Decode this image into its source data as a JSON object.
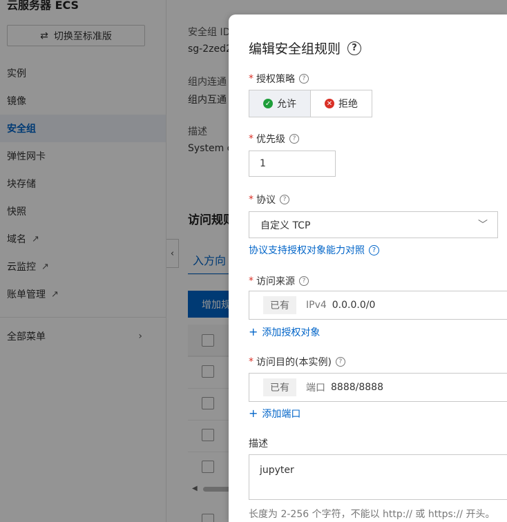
{
  "sidebar": {
    "title": "云服务器 ECS",
    "switch_button": "切换至标准版",
    "items": [
      {
        "label": "实例"
      },
      {
        "label": "镜像"
      },
      {
        "label": "安全组"
      },
      {
        "label": "弹性网卡"
      },
      {
        "label": "块存储"
      },
      {
        "label": "快照"
      },
      {
        "label": "域名"
      },
      {
        "label": "云监控"
      },
      {
        "label": "账单管理"
      }
    ],
    "all_menu": "全部菜单"
  },
  "main": {
    "sg_id_label": "安全组 ID",
    "sg_id_value": "sg-2zed2",
    "intra_label": "组内连通",
    "intra_value": "组内互通",
    "desc_label": "描述",
    "desc_value": "System c",
    "rules_title": "访问规则",
    "tab_inbound": "入方向",
    "add_rule_button": "增加规"
  },
  "drawer": {
    "title": "编辑安全组规则",
    "policy": {
      "label": "授权策略",
      "allow": "允许",
      "deny": "拒绝",
      "selected": "允许"
    },
    "priority": {
      "label": "优先级",
      "value": "1"
    },
    "protocol": {
      "label": "协议",
      "value": "自定义 TCP",
      "link": "协议支持授权对象能力对照"
    },
    "source": {
      "label": "访问来源",
      "tag": "已有",
      "key": "IPv4",
      "value": "0.0.0.0/0",
      "add_link": "添加授权对象"
    },
    "destination": {
      "label": "访问目的(本实例)",
      "tag": "已有",
      "key": "端口",
      "value": "8888/8888",
      "add_link": "添加端口"
    },
    "description": {
      "label": "描述",
      "value": "jupyter",
      "hint": "长度为 2-256 个字符，不能以 http:// 或 https:// 开头。"
    }
  },
  "colors": {
    "accent": "#0064c8",
    "required": "#d93026",
    "allow_green": "#1e9e3a",
    "overlay": "rgba(0,0,0,0.42)"
  }
}
